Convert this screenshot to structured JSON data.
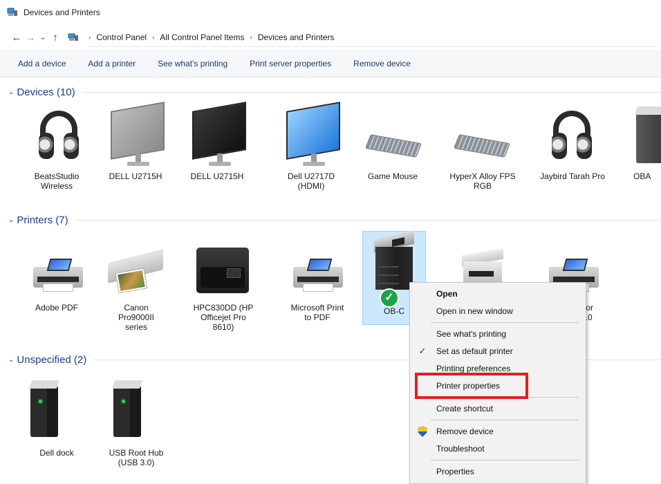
{
  "window": {
    "title": "Devices and Printers"
  },
  "addressbar": {
    "crumbs": [
      "Control Panel",
      "All Control Panel Items",
      "Devices and Printers"
    ]
  },
  "commands": [
    "Add a device",
    "Add a printer",
    "See what's printing",
    "Print server properties",
    "Remove device"
  ],
  "groups": {
    "devices": {
      "title": "Devices (10)",
      "items": [
        {
          "label": "BeatsStudio\nWireless",
          "icon": "headphones-icon"
        },
        {
          "label": "DELL U2715H",
          "icon": "monitor-icon"
        },
        {
          "label": "DELL U2715H",
          "icon": "monitor-icon"
        },
        {
          "label": "Dell U2717D\n(HDMI)",
          "icon": "monitor-icon"
        },
        {
          "label": "Game Mouse",
          "icon": "keyboard-icon"
        },
        {
          "label": "HyperX Alloy FPS\nRGB",
          "icon": "keyboard-icon"
        },
        {
          "label": "Jaybird Tarah Pro",
          "icon": "headphones-icon"
        },
        {
          "label": "OBA",
          "icon": "tower-icon"
        }
      ]
    },
    "printers": {
      "title": "Printers (7)",
      "items": [
        {
          "label": "Adobe PDF",
          "icon": "printer-icon"
        },
        {
          "label": "Canon Pro9000II\nseries",
          "icon": "photo-printer-icon"
        },
        {
          "label": "HPC830DD (HP\nOfficejet Pro\n8610)",
          "icon": "officejet-printer-icon"
        },
        {
          "label": "Microsoft Print\nto PDF",
          "icon": "printer-icon"
        },
        {
          "label": "OB-C",
          "icon": "copier-icon",
          "selected": true,
          "default": true
        },
        {
          "label": "",
          "icon": "laserjet-printer-icon"
        },
        {
          "label": "e for\ns 10",
          "icon": "printer-icon"
        }
      ]
    },
    "unspecified": {
      "title": "Unspecified (2)",
      "items": [
        {
          "label": "Dell dock",
          "icon": "tower-icon"
        },
        {
          "label": "USB Root Hub\n(USB 3.0)",
          "icon": "tower-icon"
        }
      ]
    }
  },
  "context_menu": {
    "items": [
      {
        "label": "Open",
        "bold": true
      },
      {
        "label": "Open in new window"
      },
      {
        "label": "See what's printing"
      },
      {
        "label": "Set as default printer",
        "checked": true
      },
      {
        "label": "Printing preferences"
      },
      {
        "label": "Printer properties",
        "highlighted": true
      },
      {
        "label": "Create shortcut"
      },
      {
        "label": "Remove device",
        "icon": "uac-shield-icon"
      },
      {
        "label": "Troubleshoot"
      },
      {
        "label": "Properties"
      }
    ]
  },
  "colors": {
    "group_header": "#1e3e8a",
    "selection_bg": "#cce8ff",
    "highlight_box": "#e0201e",
    "default_check": "#1ea34a"
  }
}
